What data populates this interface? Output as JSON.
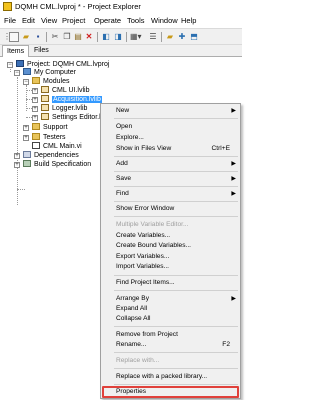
{
  "window": {
    "title": "DQMH CML.lvproj * - Project Explorer"
  },
  "menubar": [
    "File",
    "Edit",
    "View",
    "Project",
    "Operate",
    "Tools",
    "Window",
    "Help"
  ],
  "tabs": {
    "items": "Items",
    "files": "Files"
  },
  "tree": {
    "project": "Project: DQMH CML.lvproj",
    "computer": "My Computer",
    "modules": "Modules",
    "cml_ui": "CML UI.lvlib",
    "acquisition": "Acquisition.lvlib",
    "logger": "Logger.lvlib",
    "settings": "Settings Editor.l",
    "support": "Support",
    "testers": "Testers",
    "cml_main": "CML Main.vi",
    "dependencies": "Dependencies",
    "build": "Build Specification"
  },
  "context_menu": {
    "new": "New",
    "open": "Open",
    "explore": "Explore...",
    "show_in_files": "Show in Files View",
    "show_in_files_shortcut": "Ctrl+E",
    "add": "Add",
    "save": "Save",
    "find": "Find",
    "show_error": "Show Error Window",
    "multiple_editor": "Multiple Variable Editor...",
    "create_variables": "Create Variables...",
    "create_bound": "Create Bound Variables...",
    "export_vars": "Export Variables...",
    "import_vars": "Import Variables...",
    "find_items": "Find Project Items...",
    "arrange_by": "Arrange By",
    "expand_all": "Expand All",
    "collapse_all": "Collapse All",
    "remove": "Remove from Project",
    "rename": "Rename...",
    "rename_shortcut": "F2",
    "replace_with": "Replace with...",
    "replace_packed": "Replace with a packed library...",
    "properties": "Properties"
  },
  "colors": {
    "selection": "#3399ff",
    "highlight_box": "#e0413b"
  }
}
